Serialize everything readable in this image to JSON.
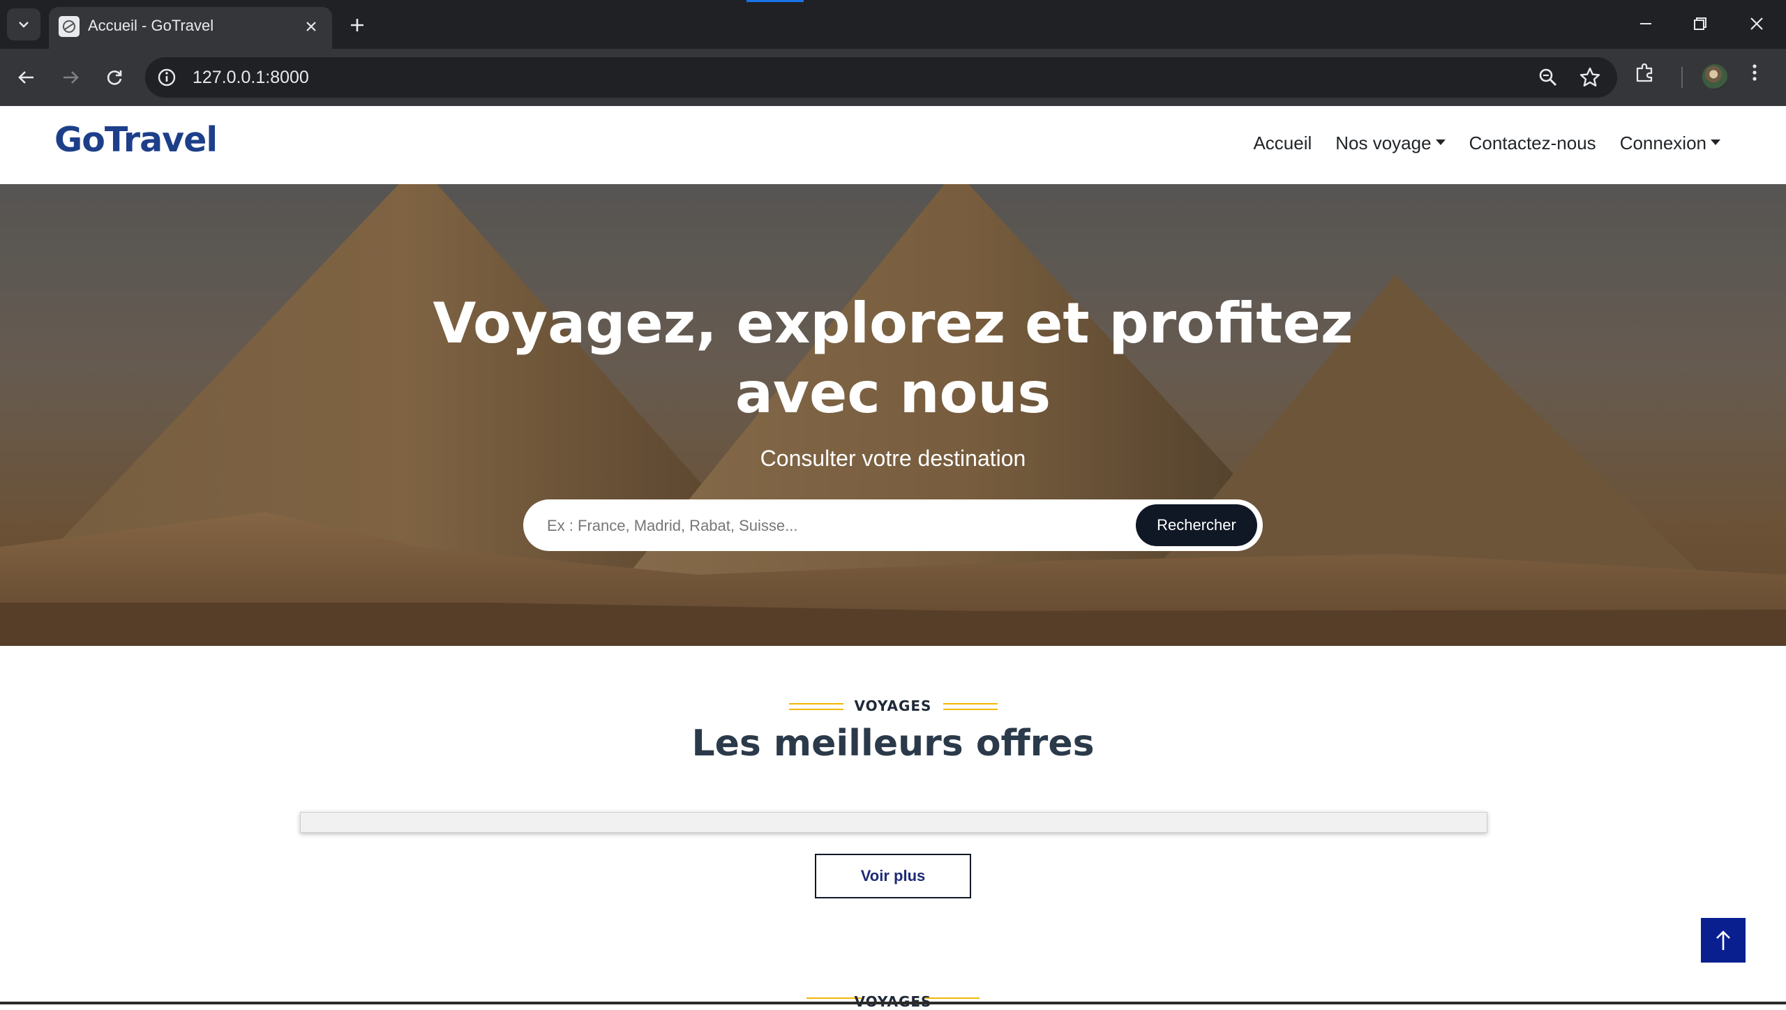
{
  "browser": {
    "tab_title": "Accueil - GoTravel",
    "url": "127.0.0.1:8000",
    "icons": [
      "tab-list-icon",
      "favicon-icon",
      "close-icon",
      "new-tab-icon",
      "minimize-icon",
      "restore-icon",
      "window-close-icon",
      "back-icon",
      "forward-icon",
      "reload-icon",
      "site-info-icon",
      "zoom-icon",
      "bookmark-star-icon",
      "extensions-icon",
      "profile-avatar",
      "menu-dots-icon"
    ]
  },
  "site": {
    "logo": "GoTravel",
    "nav": {
      "home": "Accueil",
      "trips": "Nos voyage",
      "contact": "Contactez-nous",
      "login": "Connexion"
    }
  },
  "hero": {
    "title": "Voyagez, explorez et profitez avec nous",
    "subtitle": "Consulter votre destination",
    "search_placeholder": "Ex : France, Madrid, Rabat, Suisse...",
    "search_button": "Rechercher"
  },
  "offers": {
    "tag": "VOYAGES",
    "title": "Les meilleurs offres",
    "see_more": "Voir plus"
  },
  "next_section": {
    "tag": "VOYAGES"
  },
  "colors": {
    "brand_blue": "#1d3f8a",
    "accent_yellow": "#f2b705",
    "button_dark": "#101826",
    "back_to_top": "#0a1f8f"
  }
}
